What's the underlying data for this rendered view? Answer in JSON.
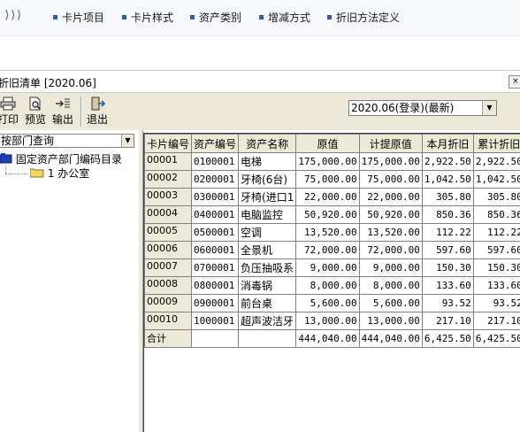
{
  "nav": {
    "chevron": "⟩⟩⟩",
    "items": [
      "卡片项目",
      "卡片样式",
      "资产类别",
      "增减方式",
      "折旧方法定义"
    ]
  },
  "window": {
    "title": "折旧清单 [2020.06]",
    "close": "×"
  },
  "toolbar": {
    "buttons": [
      "打印",
      "预览",
      "输出",
      "退出"
    ]
  },
  "period": {
    "value": "2020.06(登录)(最新)"
  },
  "left": {
    "dept_query": "按部门查询",
    "tree_root": "固定资产部门编码目录",
    "tree_child": "1 办公室"
  },
  "grid": {
    "headers": [
      "卡片编号",
      "资产编号",
      "资产名称",
      "原值",
      "计提原值",
      "本月折旧",
      "累计折旧"
    ],
    "rows": [
      [
        "00001",
        "0100001",
        "电梯",
        "175,000.00",
        "175,000.00",
        "2,922.50",
        "2,922.50"
      ],
      [
        "00002",
        "0200001",
        "牙椅(6台)",
        "75,000.00",
        "75,000.00",
        "1,042.50",
        "1,042.50"
      ],
      [
        "00003",
        "0300001",
        "牙椅(进口1",
        "22,000.00",
        "22,000.00",
        "305.80",
        "305.80"
      ],
      [
        "00004",
        "0400001",
        "电脑监控",
        "50,920.00",
        "50,920.00",
        "850.36",
        "850.36"
      ],
      [
        "00005",
        "0500001",
        "空调",
        "13,520.00",
        "13,520.00",
        "112.22",
        "112.22"
      ],
      [
        "00006",
        "0600001",
        "全景机",
        "72,000.00",
        "72,000.00",
        "597.60",
        "597.60"
      ],
      [
        "00007",
        "0700001",
        "负压抽吸系",
        "9,000.00",
        "9,000.00",
        "150.30",
        "150.30"
      ],
      [
        "00008",
        "0800001",
        "消毒锅",
        "8,000.00",
        "8,000.00",
        "133.60",
        "133.60"
      ],
      [
        "00009",
        "0900001",
        "前台桌",
        "5,600.00",
        "5,600.00",
        "93.52",
        "93.52"
      ],
      [
        "00010",
        "1000001",
        "超声波洁牙",
        "13,000.00",
        "13,000.00",
        "217.10",
        "217.10"
      ]
    ],
    "total": [
      "合计",
      "",
      "",
      "444,040.00",
      "444,040.00",
      "6,425.50",
      "6,425.50"
    ]
  },
  "colors": {
    "nav_dot": "#2a5fb0",
    "panel_bg": "#ece9d8",
    "folder": "#f0d860"
  }
}
